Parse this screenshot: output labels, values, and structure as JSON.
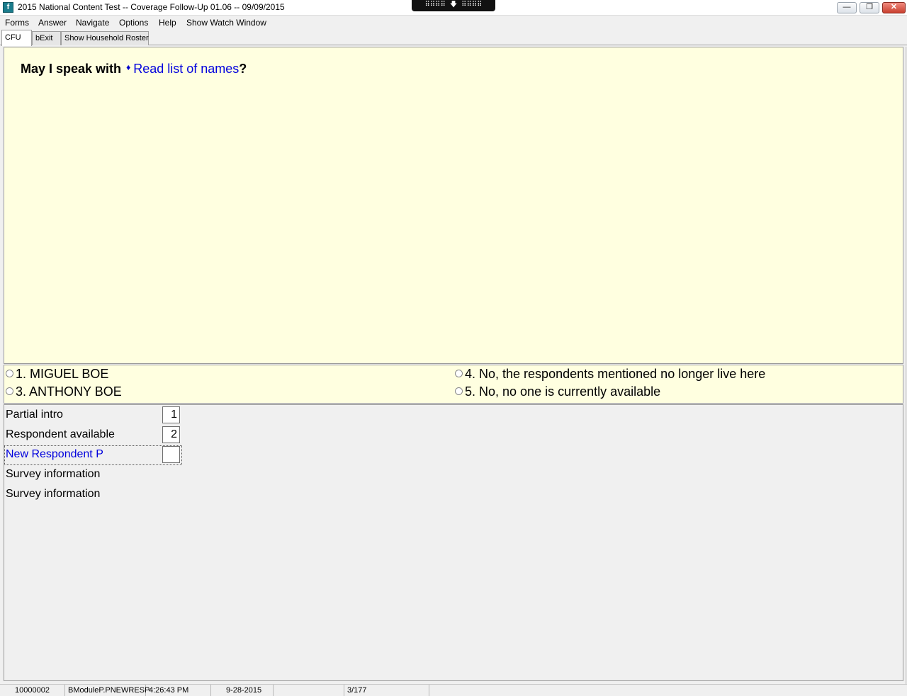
{
  "window": {
    "title": "2015 National Content Test -- Coverage Follow-Up 01.06 -- 09/09/2015",
    "app_icon_glyph": "f",
    "remote_toolbar_text": "⠿⠿⠿⠿ 🡇 ⠿⠿⠿⠿",
    "minimize_glyph": "—",
    "restore_glyph": "❐",
    "close_glyph": "✕"
  },
  "menu": {
    "items": [
      "Forms",
      "Answer",
      "Navigate",
      "Options",
      "Help",
      "Show Watch Window"
    ]
  },
  "tabs": [
    {
      "label": "CFU",
      "active": true
    },
    {
      "label": "bExit",
      "active": false
    },
    {
      "label": "Show Household Roster",
      "active": false
    }
  ],
  "question": {
    "lead": "May I speak with",
    "diamond": "♦",
    "link": "Read list of names",
    "end": "?"
  },
  "answers": [
    {
      "label": "1. MIGUEL BOE"
    },
    {
      "label": "3. ANTHONY BOE"
    },
    {
      "label": "4. No, the respondents mentioned no longer live here"
    },
    {
      "label": "5. No, no one is currently available"
    }
  ],
  "fields": [
    {
      "label": "Partial intro",
      "value": "1"
    },
    {
      "label": "Respondent available",
      "value": "2"
    },
    {
      "label": "New Respondent P",
      "value": "",
      "current": true
    },
    {
      "label": "Survey information"
    },
    {
      "label": "Survey information"
    }
  ],
  "status": {
    "case_id": "10000002",
    "field_name": "BModuleP.PNEWRESP",
    "time": "4:26:43 PM",
    "date": "9-28-2015",
    "blank": "",
    "page": "3/177"
  },
  "colors": {
    "question_bg": "#ffffe0",
    "link_blue": "#0000dd",
    "panel_bg": "#f0f0f0"
  }
}
